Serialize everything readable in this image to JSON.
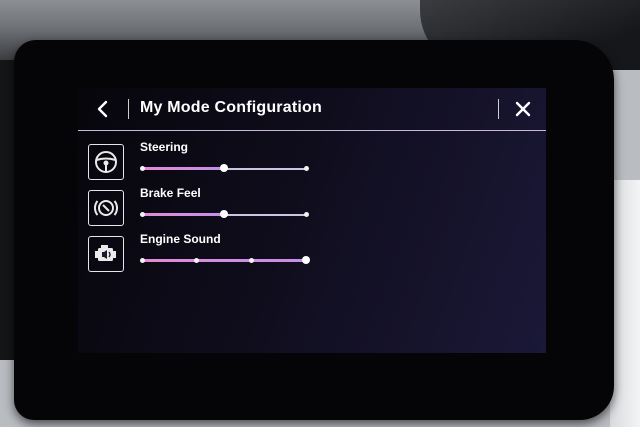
{
  "header": {
    "title": "My Mode Configuration",
    "back_icon": "chevron-left-icon",
    "close_icon": "close-icon"
  },
  "settings": [
    {
      "label": "Steering",
      "icon": "steering-wheel-icon",
      "steps": 3,
      "value_index": 1
    },
    {
      "label": "Brake Feel",
      "icon": "brake-warning-icon",
      "steps": 3,
      "value_index": 1
    },
    {
      "label": "Engine Sound",
      "icon": "engine-sound-icon",
      "steps": 4,
      "value_index": 3
    }
  ],
  "colors": {
    "accent": "#e58ad6",
    "accent_end": "#c38fe9",
    "track": "#cfc4dd",
    "screen_bg": "#0f0d1c"
  }
}
